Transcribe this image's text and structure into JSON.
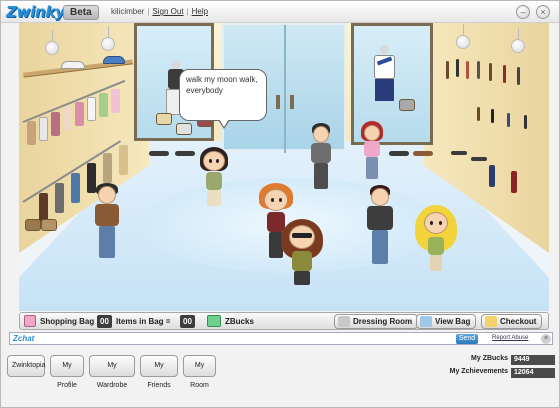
{
  "app": {
    "logo": "Zwinky",
    "badge": "Beta"
  },
  "user": {
    "name": "kilicimber",
    "sign_out": "Sign Out",
    "help": "Help"
  },
  "window_controls": {
    "minimize": "–",
    "close": "×"
  },
  "scene": {
    "speech_bubble": "walk my moon walk, everybody"
  },
  "shopping_bar": {
    "shopping_bag": "Shopping Bag",
    "bag_count": "00",
    "items_in_bag": "Items in Bag =",
    "zbucks_count": "00",
    "zbucks": "ZBucks",
    "dressing_room": "Dressing Room",
    "view_bag": "View Bag",
    "checkout": "Checkout"
  },
  "chat": {
    "label": "Zchat",
    "placeholder": "",
    "send": "Send",
    "report_abuse": "Report Abuse",
    "close": "×"
  },
  "nav": {
    "zwinktopia": "Zwinktopia",
    "my_profile": "My Profile",
    "my_wardrobe": "My Wardrobe",
    "my_friends": "My Friends",
    "my_room": "My Room"
  },
  "stats": {
    "zbucks_label": "My ZBucks",
    "zbucks_value": "9449",
    "zchievements_label": "My Zchievements",
    "zchievements_value": "12064"
  },
  "colors": {
    "brand_blue": "#2c8fd6",
    "counter_bg": "#3d3d3d"
  }
}
